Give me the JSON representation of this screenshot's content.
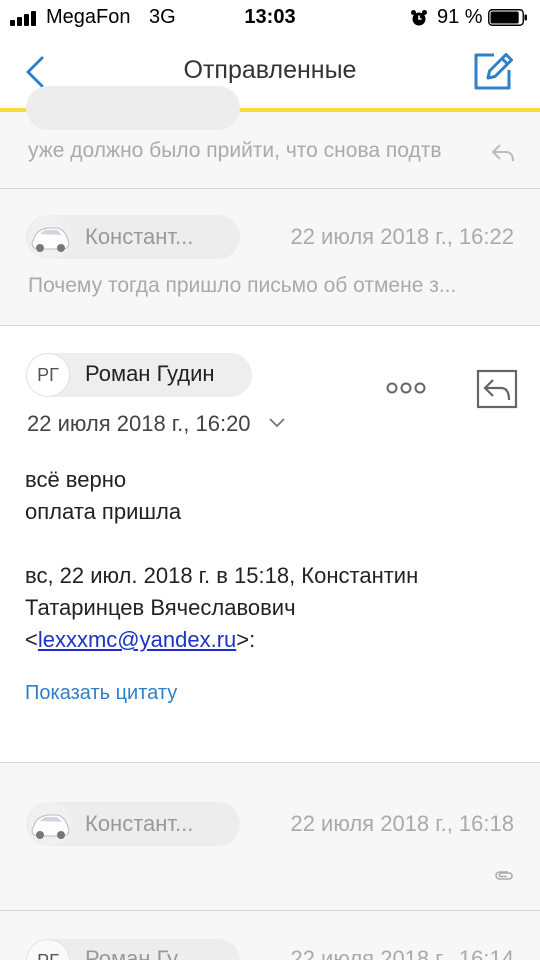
{
  "status_bar": {
    "carrier": "MegaFon",
    "network": "3G",
    "time": "13:03",
    "battery_percent": "91 %",
    "battery_level": 0.91,
    "icons": [
      "signal-icon",
      "alarm-icon",
      "battery-icon"
    ]
  },
  "navbar": {
    "title": "Отправленные",
    "back_icon": "chevron-left-icon",
    "compose_icon": "compose-icon",
    "accent_color": "#2f7fc9",
    "underline_color": "#f5dd3c"
  },
  "messages": [
    {
      "snippet": "уже должно было прийти, что снова подтв",
      "icon": "reply-icon"
    },
    {
      "sender": "Констант...",
      "date": "22 июля 2018 г., 16:22",
      "snippet": "Почему тогда пришло письмо об отмене з...",
      "avatar": "car-avatar"
    },
    {
      "sender": "Роман Гудин",
      "initials": "РГ",
      "date": "22 июля 2018 г., 16:20",
      "body": {
        "line1": "всё верно",
        "line2": "оплата пришла",
        "quote_line1": "вс, 22 июл. 2018 г. в 15:18, Константин",
        "quote_line2": "Татаринцев Вячеславович",
        "quote_email_prefix": "<",
        "quote_email": "lexxxmc@yandex.ru",
        "quote_email_suffix": ">:",
        "show_quote": "Показать цитату"
      },
      "icons": [
        "chevron-down-icon",
        "more-icon",
        "reply-icon"
      ]
    },
    {
      "sender": "Констант...",
      "date": "22 июля 2018 г., 16:18",
      "avatar": "car-avatar",
      "icon": "attachment-icon"
    },
    {
      "sender": "Роман Гу...",
      "initials": "РГ",
      "date": "22 июля 2018 г., 16:14"
    }
  ]
}
